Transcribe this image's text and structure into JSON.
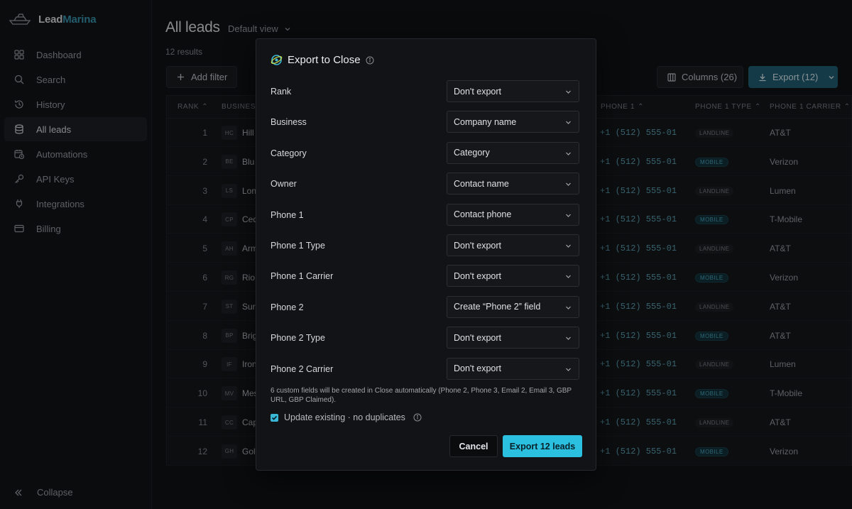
{
  "brand": {
    "name_part1": "Lead",
    "name_part2": "Marina",
    "accent_color": "#3a9ab6"
  },
  "sidebar": {
    "items": [
      {
        "label": "Dashboard",
        "icon": "dashboard-icon",
        "active": false
      },
      {
        "label": "Search",
        "icon": "search-icon",
        "active": false
      },
      {
        "label": "History",
        "icon": "history-icon",
        "active": false
      },
      {
        "label": "All leads",
        "icon": "database-icon",
        "active": true
      },
      {
        "label": "Automations",
        "icon": "calendar-clock-icon",
        "active": false
      },
      {
        "label": "API Keys",
        "icon": "key-icon",
        "active": false
      },
      {
        "label": "Integrations",
        "icon": "plug-icon",
        "active": false
      },
      {
        "label": "Billing",
        "icon": "credit-card-icon",
        "active": false
      }
    ],
    "collapse_label": "Collapse"
  },
  "main": {
    "title": "All leads",
    "view": "Default view",
    "results": "12 results",
    "add_filter": "Add filter",
    "columns_button": "Columns (26)",
    "export_button": "Export (12)"
  },
  "table": {
    "headers": {
      "rank": "RANK",
      "business": "BUSINESS",
      "phone1": "PHONE 1",
      "phone1_type": "PHONE 1 TYPE",
      "phone1_carrier": "PHONE 1 CARRIER"
    },
    "rows": [
      {
        "rank": "1",
        "initials": "HC",
        "business": "Hill",
        "phone": "+1 (512) 555-01",
        "type": "LANDLINE",
        "carrier": "AT&T"
      },
      {
        "rank": "2",
        "initials": "BE",
        "business": "Blu",
        "phone": "+1 (512) 555-01",
        "type": "MOBILE",
        "carrier": "Verizon"
      },
      {
        "rank": "3",
        "initials": "LS",
        "business": "Lon",
        "phone": "+1 (512) 555-01",
        "type": "LANDLINE",
        "carrier": "Lumen"
      },
      {
        "rank": "4",
        "initials": "CP",
        "business": "Ced",
        "phone": "+1 (512) 555-01",
        "type": "MOBILE",
        "carrier": "T-Mobile"
      },
      {
        "rank": "5",
        "initials": "AH",
        "business": "Arm",
        "phone": "+1 (512) 555-01",
        "type": "LANDLINE",
        "carrier": "AT&T"
      },
      {
        "rank": "6",
        "initials": "RG",
        "business": "Rio",
        "phone": "+1 (512) 555-01",
        "type": "MOBILE",
        "carrier": "Verizon"
      },
      {
        "rank": "7",
        "initials": "ST",
        "business": "Sur",
        "phone": "+1 (512) 555-01",
        "type": "LANDLINE",
        "carrier": "AT&T"
      },
      {
        "rank": "8",
        "initials": "BP",
        "business": "Brig",
        "phone": "+1 (512) 555-01",
        "type": "MOBILE",
        "carrier": "AT&T"
      },
      {
        "rank": "9",
        "initials": "IF",
        "business": "Iron",
        "phone": "+1 (512) 555-01",
        "type": "LANDLINE",
        "carrier": "Lumen"
      },
      {
        "rank": "10",
        "initials": "MV",
        "business": "Mes",
        "phone": "+1 (512) 555-01",
        "type": "MOBILE",
        "carrier": "T-Mobile"
      },
      {
        "rank": "11",
        "initials": "CC",
        "business": "Cap",
        "phone": "+1 (512) 555-01",
        "type": "LANDLINE",
        "carrier": "AT&T"
      },
      {
        "rank": "12",
        "initials": "GH",
        "business": "Gol",
        "phone": "+1 (512) 555-01",
        "type": "MOBILE",
        "carrier": "Verizon"
      }
    ]
  },
  "modal": {
    "title": "Export to Close",
    "fields": [
      {
        "label": "Rank",
        "value": "Don't export"
      },
      {
        "label": "Business",
        "value": "Company name"
      },
      {
        "label": "Category",
        "value": "Category"
      },
      {
        "label": "Owner",
        "value": "Contact name"
      },
      {
        "label": "Phone 1",
        "value": "Contact phone"
      },
      {
        "label": "Phone 1 Type",
        "value": "Don't export"
      },
      {
        "label": "Phone 1 Carrier",
        "value": "Don't export"
      },
      {
        "label": "Phone 2",
        "value": "Create “Phone 2” field"
      },
      {
        "label": "Phone 2 Type",
        "value": "Don't export"
      },
      {
        "label": "Phone 2 Carrier",
        "value": "Don't export"
      }
    ],
    "note": "6 custom fields will be created in Close automatically (Phone 2, Phone 3, Email 2, Email 3, GBP URL, GBP Claimed).",
    "update_existing": "Update existing · no duplicates",
    "update_checked": true,
    "cancel": "Cancel",
    "confirm": "Export 12 leads",
    "confirm_color": "#2bbfe0"
  }
}
